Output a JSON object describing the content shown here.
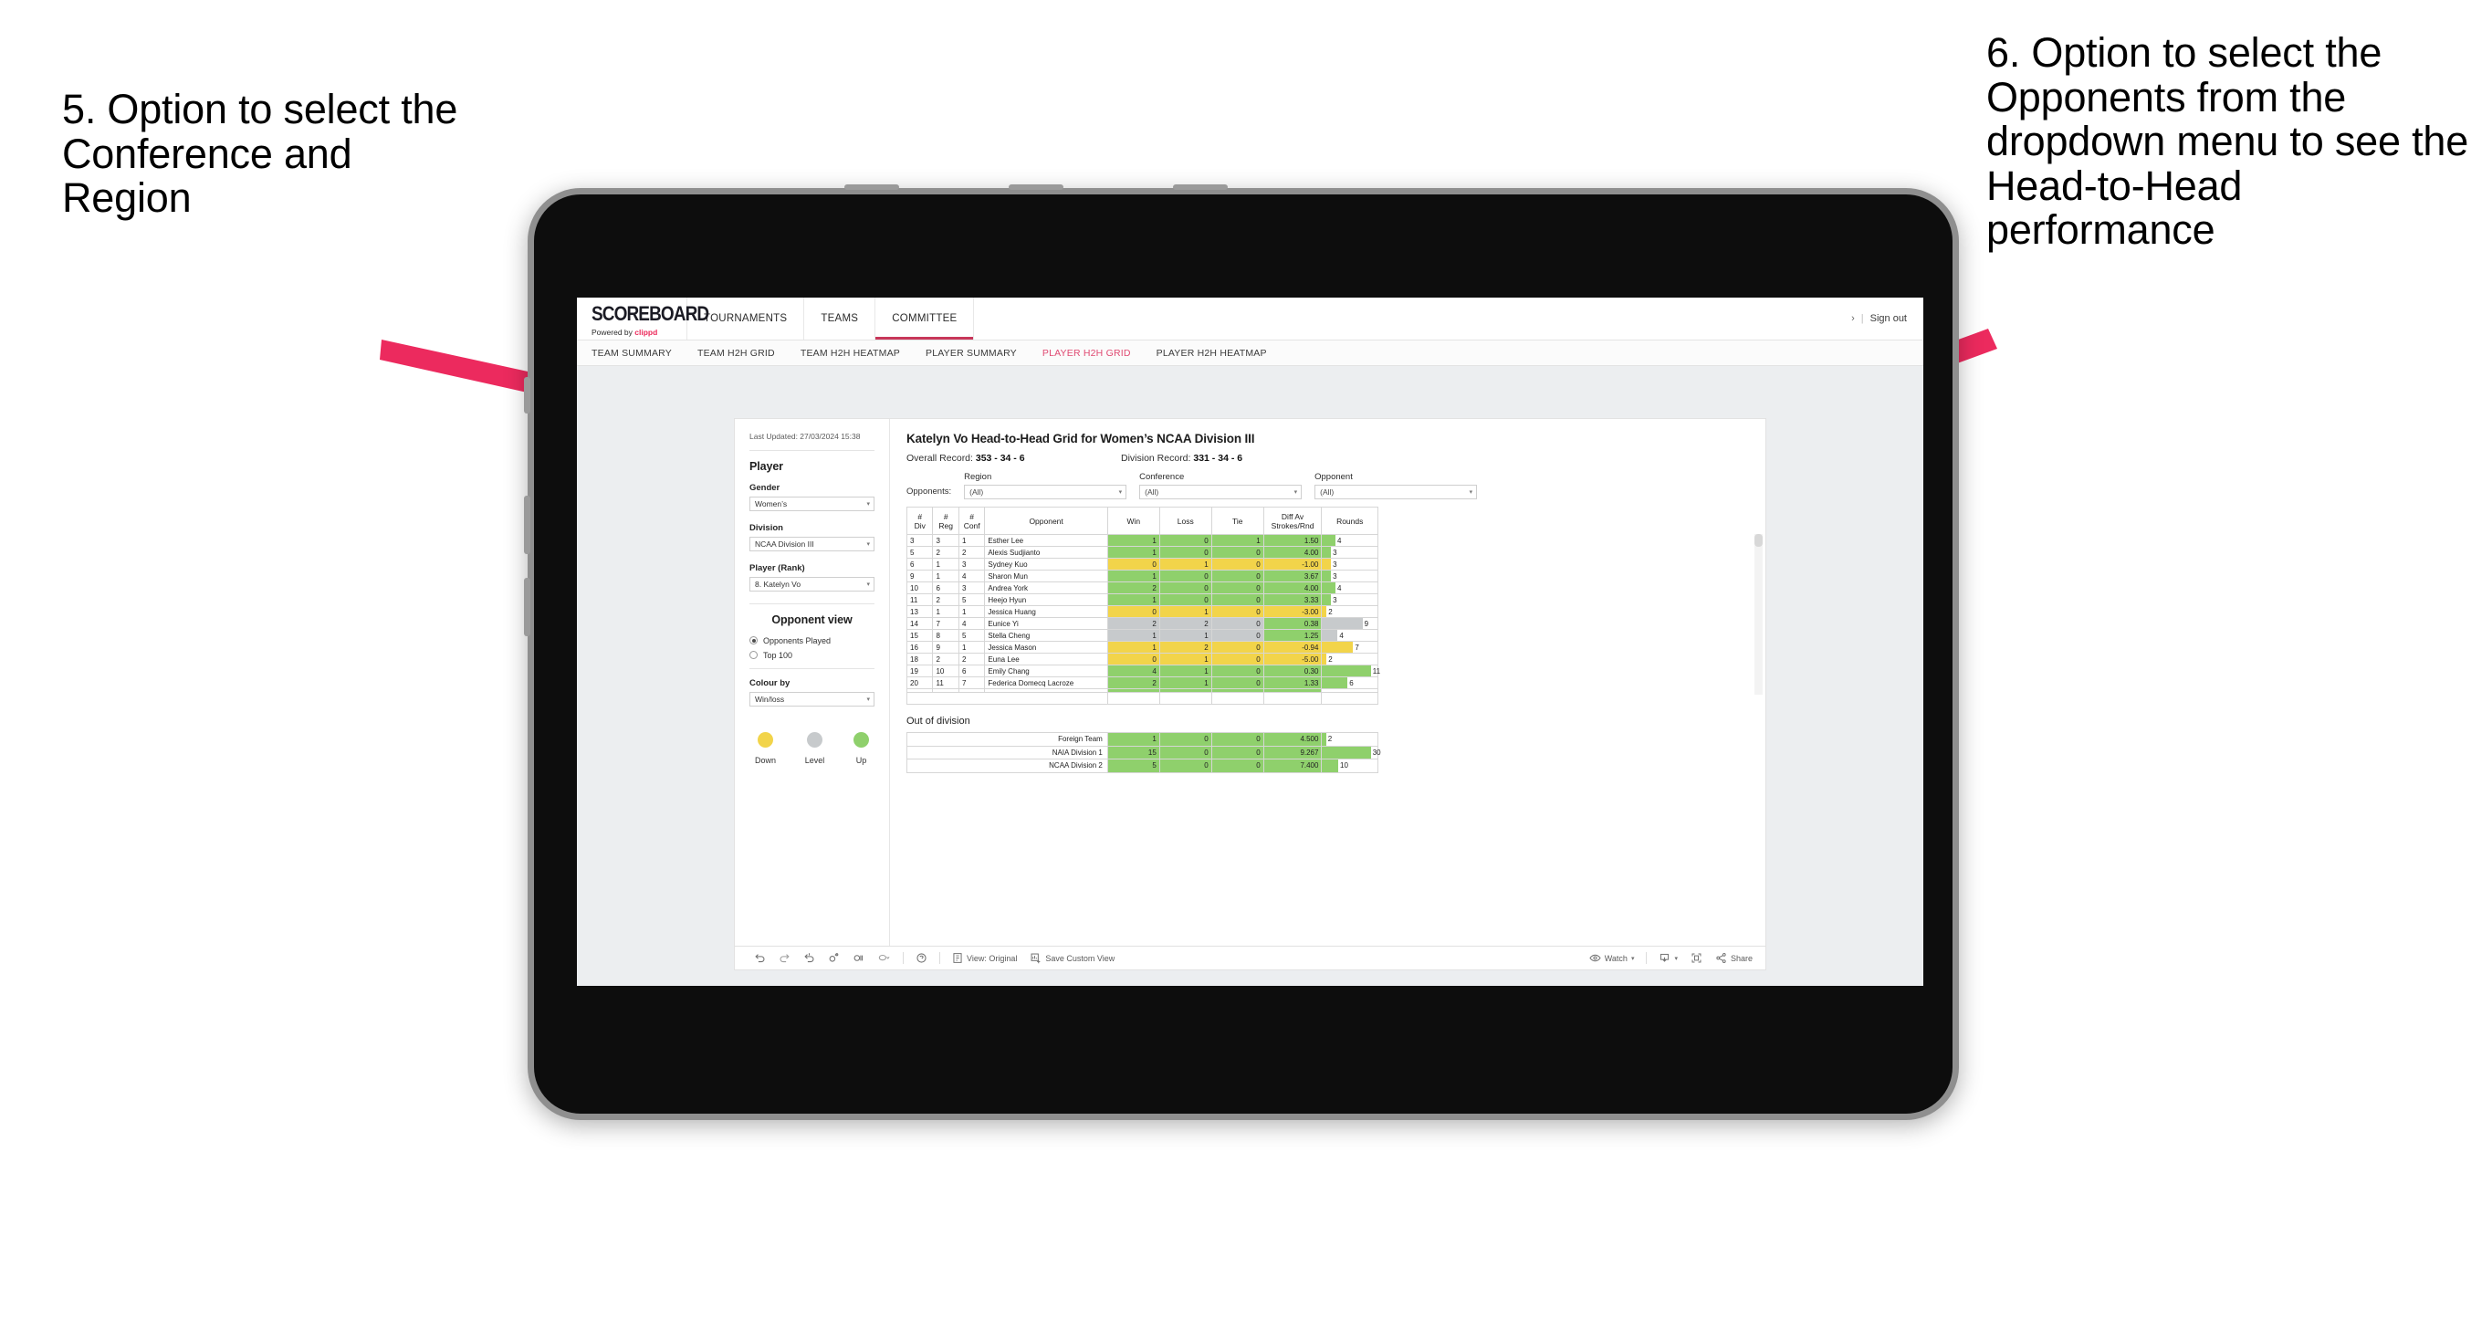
{
  "annotations": {
    "left": "5. Option to select the Conference and Region",
    "right": "6. Option to select the Opponents from the dropdown menu to see the Head-to-Head performance",
    "arrow_color": "#EC2A5E"
  },
  "header": {
    "brand_name": "SCOREBOARD",
    "brand_sub_prefix": "Powered by ",
    "brand_sub_accent": "clippd",
    "nav": [
      {
        "label": "TOURNAMENTS",
        "active": false
      },
      {
        "label": "TEAMS",
        "active": false
      },
      {
        "label": "COMMITTEE",
        "active": true
      }
    ],
    "chevron": "›",
    "separator": "|",
    "sign_out": "Sign out"
  },
  "subnav": [
    {
      "label": "TEAM SUMMARY",
      "active": false
    },
    {
      "label": "TEAM H2H GRID",
      "active": false
    },
    {
      "label": "TEAM H2H HEATMAP",
      "active": false
    },
    {
      "label": "PLAYER SUMMARY",
      "active": false
    },
    {
      "label": "PLAYER H2H GRID",
      "active": true
    },
    {
      "label": "PLAYER H2H HEATMAP",
      "active": false
    }
  ],
  "sidebar": {
    "last_updated": "Last Updated: 27/03/2024 15:38",
    "player_heading": "Player",
    "gender_label": "Gender",
    "gender_value": "Women’s",
    "division_label": "Division",
    "division_value": "NCAA Division III",
    "player_rank_label": "Player (Rank)",
    "player_rank_value": "8. Katelyn Vo",
    "opponent_view_heading": "Opponent view",
    "opponent_view_options": [
      {
        "label": "Opponents Played",
        "selected": true
      },
      {
        "label": "Top 100",
        "selected": false
      }
    ],
    "colour_by_label": "Colour by",
    "colour_by_value": "Win/loss",
    "legend": [
      {
        "label": "Down",
        "color": "#F2D44A"
      },
      {
        "label": "Level",
        "color": "#C7CACC"
      },
      {
        "label": "Up",
        "color": "#8FD06C"
      }
    ],
    "caret": "▾"
  },
  "main": {
    "title": "Katelyn Vo Head-to-Head Grid for Women’s NCAA Division III",
    "overall_record_label": "Overall Record: ",
    "overall_record_value": "353 - 34 - 6",
    "division_record_label": "Division Record: ",
    "division_record_value": "331 - 34 - 6",
    "opponents_label": "Opponents:",
    "filters": [
      {
        "label": "Region",
        "value": "(All)"
      },
      {
        "label": "Conference",
        "value": "(All)"
      },
      {
        "label": "Opponent",
        "value": "(All)"
      }
    ],
    "caret": "▾",
    "columns": [
      "# Div",
      "# Reg",
      "# Conf",
      "Opponent",
      "Win",
      "Loss",
      "Tie",
      "Diff Av Strokes/Rnd",
      "Rounds"
    ],
    "column_lines": [
      [
        "#",
        "Div"
      ],
      [
        "#",
        "Reg"
      ],
      [
        "#",
        "Conf"
      ],
      [
        "Opponent",
        ""
      ],
      [
        "Win",
        ""
      ],
      [
        "Loss",
        ""
      ],
      [
        "Tie",
        ""
      ],
      [
        "Diff Av",
        "Strokes/Rnd"
      ],
      [
        "Rounds",
        ""
      ]
    ],
    "rows": [
      {
        "div": "3",
        "reg": "3",
        "conf": "1",
        "opponent": "Esther Lee",
        "win": "1",
        "loss": "0",
        "tie": "1",
        "diff": "1.50",
        "rounds": "4",
        "color": "#8FD06C",
        "bar_pct": 24
      },
      {
        "div": "5",
        "reg": "2",
        "conf": "2",
        "opponent": "Alexis Sudjianto",
        "win": "1",
        "loss": "0",
        "tie": "0",
        "diff": "4.00",
        "rounds": "3",
        "color": "#8FD06C",
        "bar_pct": 16
      },
      {
        "div": "6",
        "reg": "1",
        "conf": "3",
        "opponent": "Sydney Kuo",
        "win": "0",
        "loss": "1",
        "tie": "0",
        "diff": "-1.00",
        "rounds": "3",
        "color": "#F2D44A",
        "bar_pct": 16
      },
      {
        "div": "9",
        "reg": "1",
        "conf": "4",
        "opponent": "Sharon Mun",
        "win": "1",
        "loss": "0",
        "tie": "0",
        "diff": "3.67",
        "rounds": "3",
        "color": "#8FD06C",
        "bar_pct": 16
      },
      {
        "div": "10",
        "reg": "6",
        "conf": "3",
        "opponent": "Andrea York",
        "win": "2",
        "loss": "0",
        "tie": "0",
        "diff": "4.00",
        "rounds": "4",
        "color": "#8FD06C",
        "bar_pct": 24
      },
      {
        "div": "11",
        "reg": "2",
        "conf": "5",
        "opponent": "Heejo Hyun",
        "win": "1",
        "loss": "0",
        "tie": "0",
        "diff": "3.33",
        "rounds": "3",
        "color": "#8FD06C",
        "bar_pct": 16
      },
      {
        "div": "13",
        "reg": "1",
        "conf": "1",
        "opponent": "Jessica Huang",
        "win": "0",
        "loss": "1",
        "tie": "0",
        "diff": "-3.00",
        "rounds": "2",
        "color": "#F2D44A",
        "bar_pct": 8
      },
      {
        "div": "14",
        "reg": "7",
        "conf": "4",
        "opponent": "Eunice Yi",
        "win": "2",
        "loss": "2",
        "tie": "0",
        "diff": "0.38",
        "rounds": "9",
        "color": "#C7CACC",
        "bar_pct": 73,
        "diff_color": "#8FD06C"
      },
      {
        "div": "15",
        "reg": "8",
        "conf": "5",
        "opponent": "Stella Cheng",
        "win": "1",
        "loss": "1",
        "tie": "0",
        "diff": "1.25",
        "rounds": "4",
        "color": "#C7CACC",
        "bar_pct": 28,
        "diff_color": "#8FD06C"
      },
      {
        "div": "16",
        "reg": "9",
        "conf": "1",
        "opponent": "Jessica Mason",
        "win": "1",
        "loss": "2",
        "tie": "0",
        "diff": "-0.94",
        "rounds": "7",
        "color": "#F2D44A",
        "bar_pct": 56
      },
      {
        "div": "18",
        "reg": "2",
        "conf": "2",
        "opponent": "Euna Lee",
        "win": "0",
        "loss": "1",
        "tie": "0",
        "diff": "-5.00",
        "rounds": "2",
        "color": "#F2D44A",
        "bar_pct": 8
      },
      {
        "div": "19",
        "reg": "10",
        "conf": "6",
        "opponent": "Emily Chang",
        "win": "4",
        "loss": "1",
        "tie": "0",
        "diff": "0.30",
        "rounds": "11",
        "color": "#8FD06C",
        "bar_pct": 88
      },
      {
        "div": "20",
        "reg": "11",
        "conf": "7",
        "opponent": "Federica Domecq Lacroze",
        "win": "2",
        "loss": "1",
        "tie": "0",
        "diff": "1.33",
        "rounds": "6",
        "color": "#8FD06C",
        "bar_pct": 46
      }
    ],
    "out_of_division_title": "Out of division",
    "out_of_division_rows": [
      {
        "label": "Foreign Team",
        "win": "1",
        "loss": "0",
        "tie": "0",
        "diff": "4.500",
        "rounds": "2",
        "color": "#8FD06C",
        "bar_pct": 7
      },
      {
        "label": "NAIA Division 1",
        "win": "15",
        "loss": "0",
        "tie": "0",
        "diff": "9.267",
        "rounds": "30",
        "color": "#8FD06C",
        "bar_pct": 88
      },
      {
        "label": "NCAA Division 2",
        "win": "5",
        "loss": "0",
        "tie": "0",
        "diff": "7.400",
        "rounds": "10",
        "color": "#8FD06C",
        "bar_pct": 29
      }
    ]
  },
  "toolbar": {
    "view_label": "View: Original",
    "save_custom_view_label": "Save Custom View",
    "watch_label": "Watch",
    "share_label": "Share",
    "caret": "▾"
  }
}
